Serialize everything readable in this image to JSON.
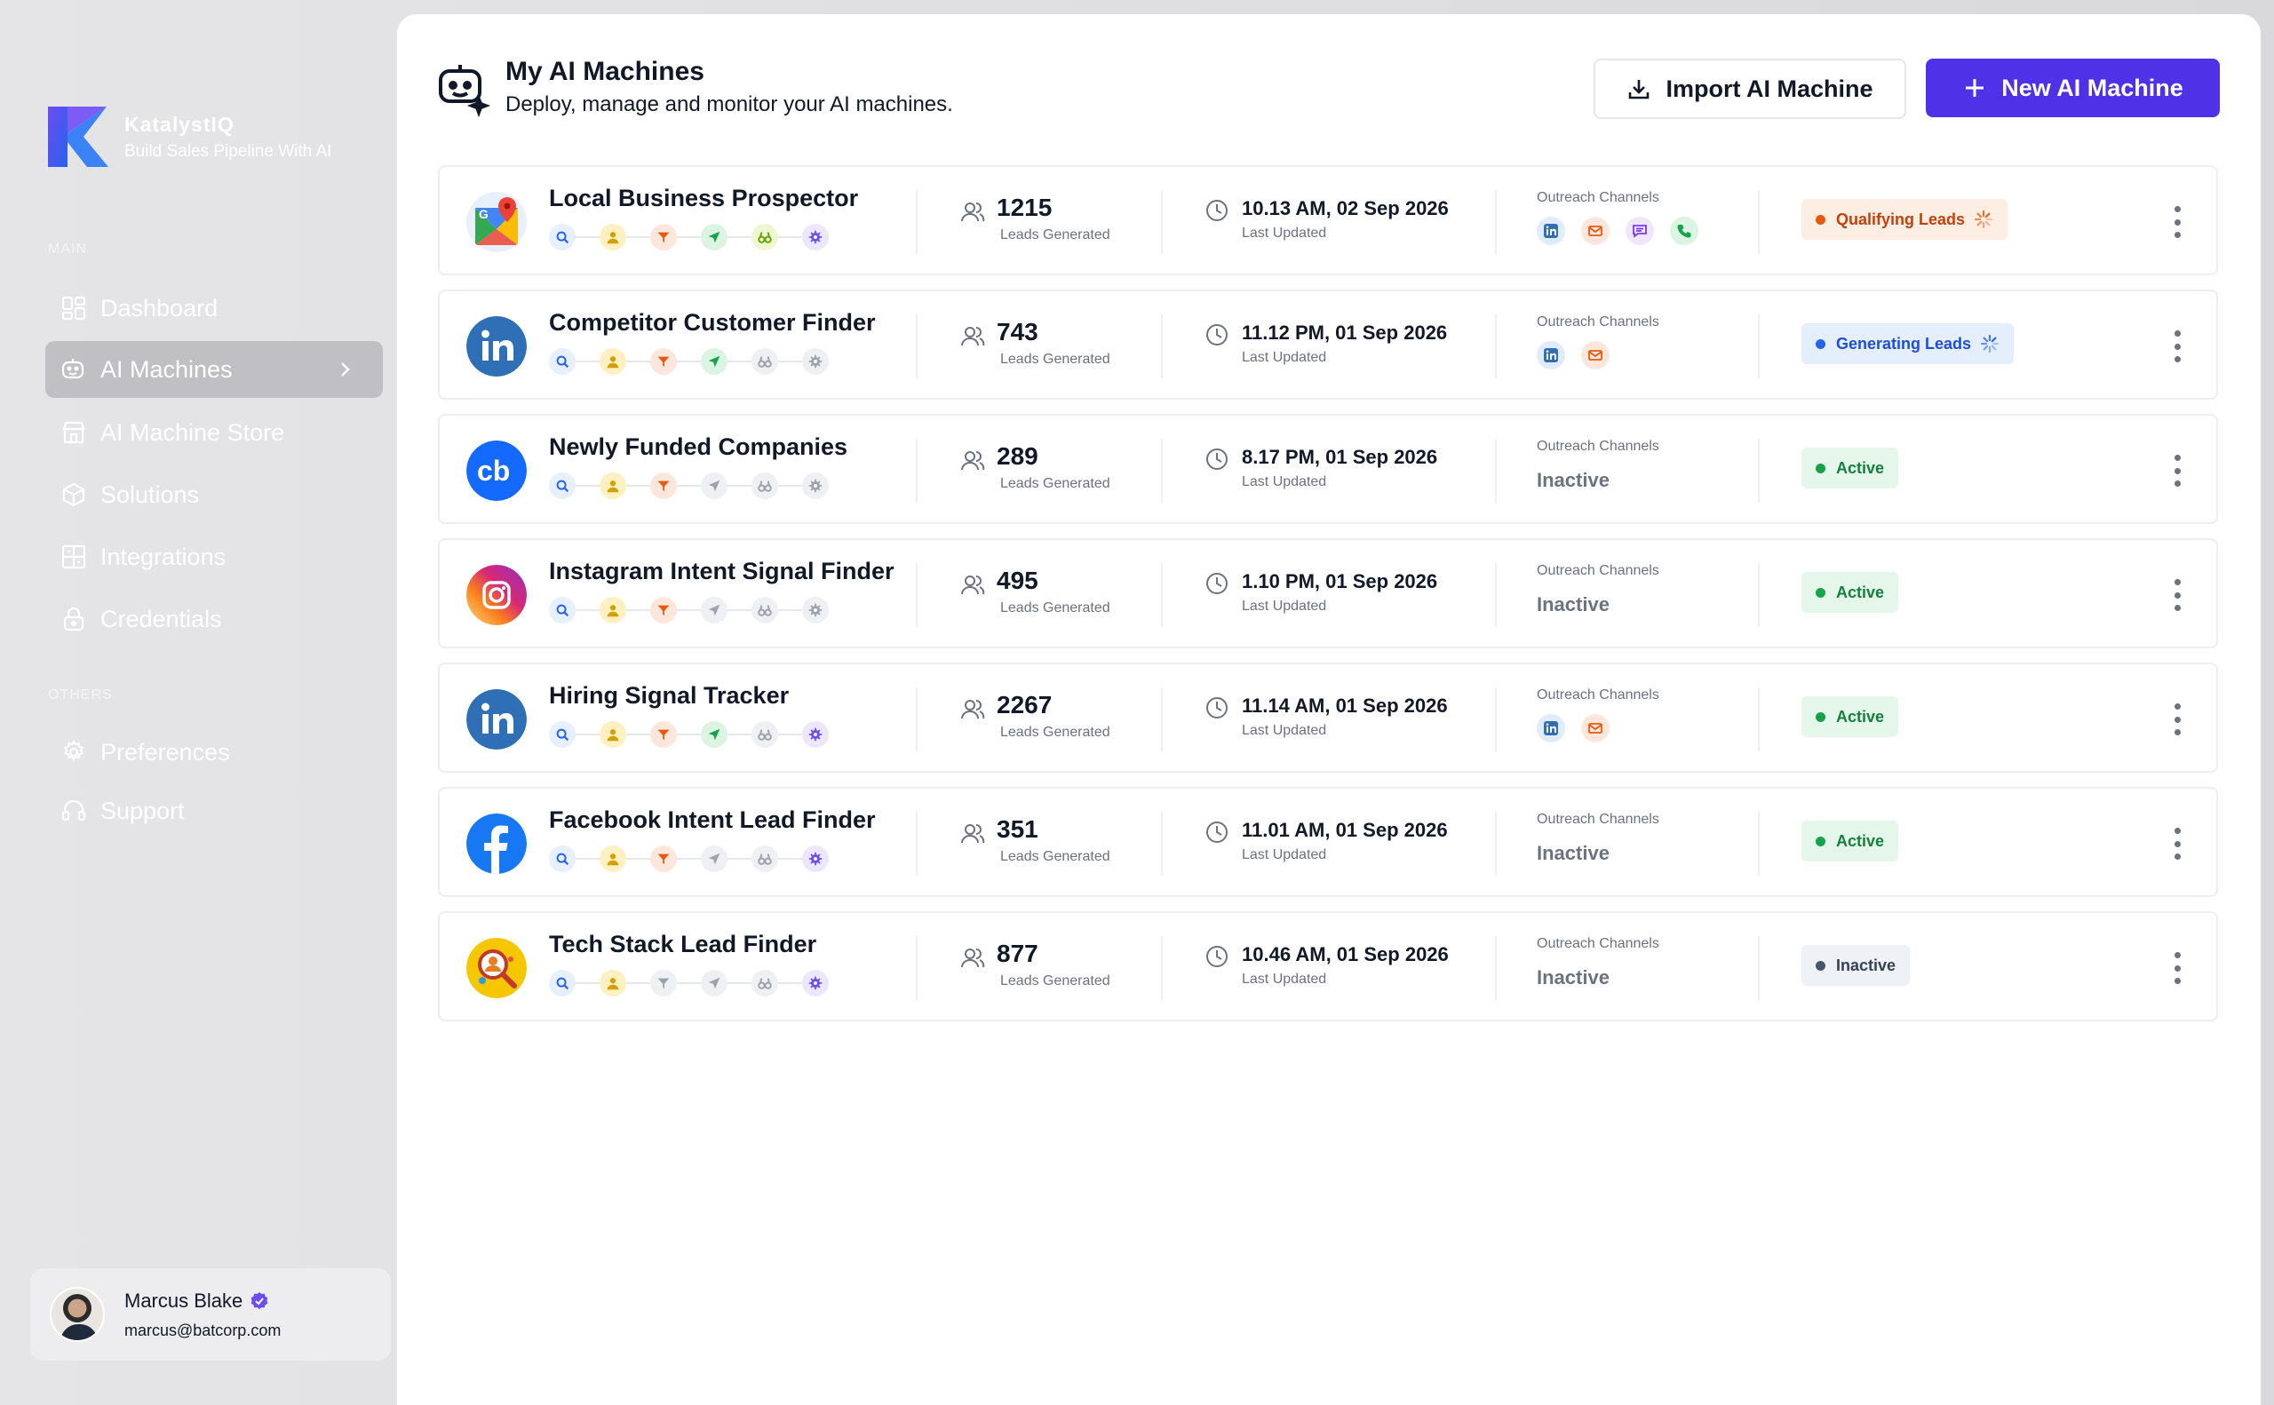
{
  "brand": {
    "name": "KatalystIQ",
    "tagline": "Build Sales Pipeline With AI"
  },
  "sidebar": {
    "main_label": "MAIN",
    "others_label": "OTHERS",
    "items": [
      {
        "label": "Dashboard",
        "icon": "dashboard-icon"
      },
      {
        "label": "AI Machines",
        "icon": "robot-icon",
        "active": true
      },
      {
        "label": "AI Machine Store",
        "icon": "store-icon"
      },
      {
        "label": "Solutions",
        "icon": "cube-icon"
      },
      {
        "label": "Integrations",
        "icon": "integrations-icon"
      },
      {
        "label": "Credentials",
        "icon": "lock-icon"
      }
    ],
    "others": [
      {
        "label": "Preferences",
        "icon": "gear-icon"
      },
      {
        "label": "Support",
        "icon": "headset-icon"
      }
    ]
  },
  "user": {
    "name": "Marcus Blake",
    "email": "marcus@batcorp.com"
  },
  "header": {
    "title": "My AI Machines",
    "subtitle": "Deploy, manage and monitor your AI machines.",
    "import_label": "Import AI Machine",
    "new_label": "New AI Machine"
  },
  "labels": {
    "leads_caption": "Leads Generated",
    "updated_caption": "Last Updated",
    "channels_caption": "Outreach Channels",
    "inactive_text": "Inactive"
  },
  "colors": {
    "accent": "#4f31e8",
    "active": "#16a34a",
    "qualifying": "#ea580c",
    "generating": "#2563eb",
    "inactive": "#475569"
  },
  "machines": [
    {
      "name": "Local Business Prospector",
      "logo": "google-maps",
      "leads": "1215",
      "updated": "10.13 AM, 02 Sep 2026",
      "channels": [
        "linkedin",
        "email",
        "sms",
        "phone"
      ],
      "status": "Qualifying Leads",
      "status_type": "qualifying",
      "steps_on": [
        true,
        true,
        true,
        true,
        true,
        true
      ]
    },
    {
      "name": "Competitor Customer Finder",
      "logo": "linkedin",
      "leads": "743",
      "updated": "11.12 PM, 01 Sep 2026",
      "channels": [
        "linkedin",
        "email"
      ],
      "status": "Generating Leads",
      "status_type": "generating",
      "steps_on": [
        true,
        true,
        true,
        true,
        false,
        false
      ]
    },
    {
      "name": "Newly Funded Companies",
      "logo": "crunchbase",
      "leads": "289",
      "updated": "8.17 PM, 01 Sep 2026",
      "channels": [],
      "status": "Active",
      "status_type": "active",
      "steps_on": [
        true,
        true,
        true,
        false,
        false,
        false
      ]
    },
    {
      "name": "Instagram Intent Signal Finder",
      "logo": "instagram",
      "leads": "495",
      "updated": "1.10 PM, 01 Sep 2026",
      "channels": [],
      "status": "Active",
      "status_type": "active",
      "steps_on": [
        true,
        true,
        true,
        false,
        false,
        false
      ]
    },
    {
      "name": "Hiring Signal Tracker",
      "logo": "linkedin",
      "leads": "2267",
      "updated": "11.14 AM, 01 Sep 2026",
      "channels": [
        "linkedin",
        "email"
      ],
      "status": "Active",
      "status_type": "active",
      "steps_on": [
        true,
        true,
        true,
        true,
        false,
        true
      ]
    },
    {
      "name": "Facebook Intent Lead Finder",
      "logo": "facebook",
      "leads": "351",
      "updated": "11.01 AM, 01 Sep 2026",
      "channels": [],
      "status": "Active",
      "status_type": "active",
      "steps_on": [
        true,
        true,
        true,
        false,
        false,
        true
      ]
    },
    {
      "name": "Tech Stack Lead Finder",
      "logo": "techstack",
      "leads": "877",
      "updated": "10.46 AM, 01 Sep 2026",
      "channels": [],
      "status": "Inactive",
      "status_type": "inactive",
      "steps_on": [
        true,
        true,
        false,
        false,
        false,
        true
      ]
    }
  ]
}
